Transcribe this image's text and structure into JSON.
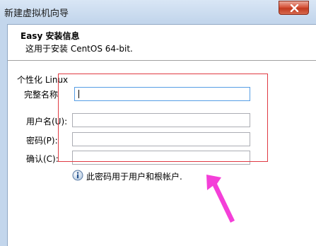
{
  "window": {
    "title": "新建虚拟机向导"
  },
  "header": {
    "title": "Easy 安装信息",
    "subtitle": "这用于安装 CentOS 64-bit."
  },
  "personalize": {
    "group_label": "个性化 Linux",
    "fields": [
      {
        "label": "完整名称",
        "value": ""
      },
      {
        "label": "用户名(U):",
        "value": ""
      },
      {
        "label": "密码(P):",
        "value": ""
      },
      {
        "label": "确认(C):",
        "value": ""
      }
    ]
  },
  "info": {
    "icon": "info-icon",
    "text": "此密码用于用户和根帐户."
  },
  "colors": {
    "annotation_rect": "#e03a43",
    "annotation_arrow": "#f43fd8",
    "focus_border": "#569de5",
    "close_button": "#c9432a"
  }
}
